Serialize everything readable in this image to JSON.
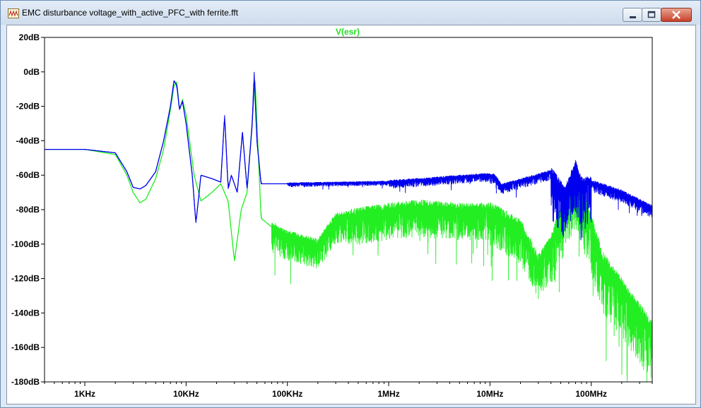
{
  "window": {
    "title": "EMC disturbance voltage_with_active_PFC_with ferrite.fft"
  },
  "icons": {
    "app": "waveform-icon",
    "minimize": "minimize-icon",
    "maximize": "maximize-icon",
    "close": "close-icon"
  },
  "chart_data": {
    "type": "line",
    "title": "V(esr)",
    "title_color": "#22dd22",
    "xscale": "log",
    "xlim": [
      400,
      400000000
    ],
    "ylim": [
      -180,
      20
    ],
    "yticks": [
      {
        "v": 20,
        "label": "20dB"
      },
      {
        "v": 0,
        "label": "0dB"
      },
      {
        "v": -20,
        "label": "-20dB"
      },
      {
        "v": -40,
        "label": "-40dB"
      },
      {
        "v": -60,
        "label": "-60dB"
      },
      {
        "v": -80,
        "label": "-80dB"
      },
      {
        "v": -100,
        "label": "-100dB"
      },
      {
        "v": -120,
        "label": "-120dB"
      },
      {
        "v": -140,
        "label": "-140dB"
      },
      {
        "v": -160,
        "label": "-160dB"
      },
      {
        "v": -180,
        "label": "-180dB"
      }
    ],
    "xticks": [
      {
        "v": 1000,
        "label": "1KHz"
      },
      {
        "v": 10000,
        "label": "10KHz"
      },
      {
        "v": 100000,
        "label": "100KHz"
      },
      {
        "v": 1000000,
        "label": "1MHz"
      },
      {
        "v": 10000000,
        "label": "10MHz"
      },
      {
        "v": 100000000,
        "label": "100MHz"
      }
    ],
    "grid": false,
    "series": [
      {
        "color": "#22ee22",
        "points": [
          [
            400,
            -45
          ],
          [
            1000,
            -45
          ],
          [
            2000,
            -48
          ],
          [
            2600,
            -60
          ],
          [
            3000,
            -70
          ],
          [
            3500,
            -76
          ],
          [
            4000,
            -74
          ],
          [
            5000,
            -62
          ],
          [
            6000,
            -45
          ],
          [
            7000,
            -22
          ],
          [
            7600,
            -8
          ],
          [
            8100,
            -6
          ],
          [
            8600,
            -22
          ],
          [
            9200,
            -16
          ],
          [
            10000,
            -25
          ],
          [
            12000,
            -60
          ],
          [
            14000,
            -75
          ],
          [
            18000,
            -70
          ],
          [
            22000,
            -65
          ],
          [
            26000,
            -75
          ],
          [
            30000,
            -110
          ],
          [
            35000,
            -80
          ],
          [
            40000,
            -70
          ],
          [
            48000,
            -5
          ],
          [
            55000,
            -85
          ],
          [
            70000,
            -90
          ],
          [
            100000,
            -95
          ],
          [
            200000,
            -100
          ],
          [
            300000,
            -85
          ],
          [
            600000,
            -82
          ],
          [
            1000000,
            -80
          ],
          [
            2000000,
            -78
          ],
          [
            5000000,
            -80
          ],
          [
            10000000,
            -80
          ],
          [
            20000000,
            -90
          ],
          [
            30000000,
            -110
          ],
          [
            40000000,
            -100
          ],
          [
            55000000,
            -75
          ],
          [
            70000000,
            -60
          ],
          [
            90000000,
            -80
          ],
          [
            130000000,
            -110
          ],
          [
            200000000,
            -125
          ],
          [
            400000000,
            -150
          ]
        ],
        "noise": [
          [
            70000,
            400000,
            15,
            8
          ],
          [
            400000,
            10000000,
            18,
            10
          ],
          [
            10000000,
            40000000,
            22,
            12
          ],
          [
            40000000,
            400000000,
            30,
            14
          ]
        ]
      },
      {
        "color": "#0000ee",
        "points": [
          [
            400,
            -45
          ],
          [
            1000,
            -45
          ],
          [
            2000,
            -47
          ],
          [
            2600,
            -58
          ],
          [
            3000,
            -67
          ],
          [
            3500,
            -68
          ],
          [
            4000,
            -66
          ],
          [
            5000,
            -58
          ],
          [
            6000,
            -40
          ],
          [
            7000,
            -20
          ],
          [
            7600,
            -5
          ],
          [
            8100,
            -8
          ],
          [
            8600,
            -22
          ],
          [
            9200,
            -17
          ],
          [
            10000,
            -30
          ],
          [
            11500,
            -60
          ],
          [
            12500,
            -88
          ],
          [
            14000,
            -60
          ],
          [
            18000,
            -62
          ],
          [
            22000,
            -64
          ],
          [
            24000,
            -25
          ],
          [
            26000,
            -68
          ],
          [
            28000,
            -60
          ],
          [
            32000,
            -70
          ],
          [
            36000,
            -35
          ],
          [
            40000,
            -68
          ],
          [
            45000,
            -30
          ],
          [
            47000,
            0
          ],
          [
            50000,
            -40
          ],
          [
            55000,
            -65
          ],
          [
            80000,
            -65
          ],
          [
            100000,
            -65
          ],
          [
            1000000,
            -64
          ],
          [
            3000000,
            -62
          ],
          [
            8000000,
            -60
          ],
          [
            11000000,
            -60
          ],
          [
            13000000,
            -66
          ],
          [
            20000000,
            -63
          ],
          [
            40000000,
            -58
          ],
          [
            55000000,
            -70
          ],
          [
            70000000,
            -54
          ],
          [
            80000000,
            -64
          ],
          [
            100000000,
            -64
          ],
          [
            200000000,
            -70
          ],
          [
            400000000,
            -79
          ]
        ],
        "noise": [
          [
            100000,
            1000000,
            2,
            2
          ],
          [
            1000000,
            10000000,
            4,
            3
          ],
          [
            10000000,
            40000000,
            5,
            3
          ],
          [
            40000000,
            100000000,
            28,
            8
          ],
          [
            100000000,
            400000000,
            6,
            4
          ]
        ]
      }
    ]
  }
}
